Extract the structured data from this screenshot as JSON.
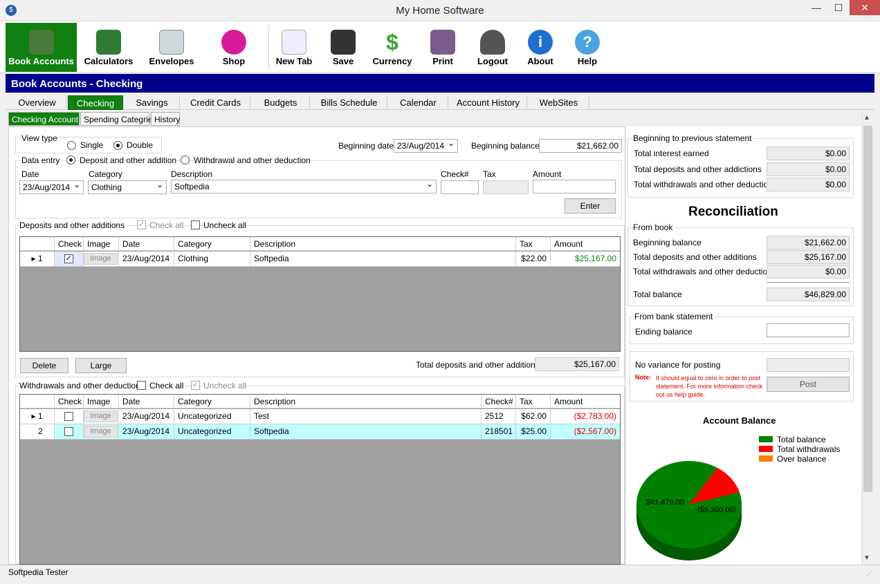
{
  "window": {
    "title": "My Home Software"
  },
  "toolbar": {
    "items": [
      {
        "label": "Book Accounts",
        "icon": "book-accounts-icon"
      },
      {
        "label": "Calculators",
        "icon": "calculator-icon"
      },
      {
        "label": "Envelopes",
        "icon": "envelopes-icon"
      },
      {
        "label": "Shop",
        "icon": "shop-icon"
      },
      {
        "label": "New Tab",
        "icon": "new-tab-icon"
      },
      {
        "label": "Save",
        "icon": "save-icon"
      },
      {
        "label": "Currency",
        "icon": "currency-icon"
      },
      {
        "label": "Print",
        "icon": "print-icon"
      },
      {
        "label": "Logout",
        "icon": "logout-icon"
      },
      {
        "label": "About",
        "icon": "about-icon"
      },
      {
        "label": "Help",
        "icon": "help-icon"
      }
    ]
  },
  "banner": {
    "title": "Book Accounts - Checking"
  },
  "tabs": [
    "Overview",
    "Checking",
    "Savings",
    "Credit Cards",
    "Budgets",
    "Bills Schedule",
    "Calendar",
    "Account History",
    "WebSites"
  ],
  "subtabs": [
    "Checking Account",
    "Spending Categries",
    "History"
  ],
  "view_type": {
    "label": "View type",
    "single": "Single",
    "double": "Double",
    "selected": "Double"
  },
  "beginning": {
    "date_label": "Beginning date",
    "date": "23/Aug/2014",
    "balance_label": "Beginning balance",
    "balance": "$21,662.00"
  },
  "data_entry": {
    "label": "Data entry",
    "deposit": "Deposit and other addition",
    "withdrawal": "Withdrawal and other deduction",
    "date_label": "Date",
    "date": "23/Aug/2014",
    "category_label": "Category",
    "category": "Clothing",
    "description_label": "Description",
    "description": "Softpedia",
    "check_label": "Check#",
    "tax_label": "Tax",
    "amount_label": "Amount",
    "enter": "Enter"
  },
  "deposits": {
    "title": "Deposits and other additions",
    "check_all": "Check all",
    "uncheck_all": "Uncheck all",
    "columns": [
      "Check",
      "Image",
      "Date",
      "Category",
      "Description",
      "Tax",
      "Amount"
    ],
    "rows": [
      {
        "n": "1",
        "image": "Image",
        "date": "23/Aug/2014",
        "category": "Clothing",
        "description": "Softpedia",
        "tax": "$22.00",
        "amount": "$25,167.00",
        "checked": true
      }
    ],
    "delete": "Delete",
    "large": "Large",
    "total_label": "Total deposits  and other additions",
    "total": "$25,167.00"
  },
  "withdrawals": {
    "title": "Withdrawals  and other deductions",
    "check_all": "Check all",
    "uncheck_all": "Uncheck all",
    "columns": [
      "Check",
      "Image",
      "Date",
      "Category",
      "Description",
      "Check#",
      "Tax",
      "Amount"
    ],
    "rows": [
      {
        "n": "1",
        "image": "Image",
        "date": "23/Aug/2014",
        "category": "Uncategorized",
        "description": "Test",
        "check": "2512",
        "tax": "$62.00",
        "amount": "($2,783.00)"
      },
      {
        "n": "2",
        "image": "Image",
        "date": "23/Aug/2014",
        "category": "Uncategorized",
        "description": "Softpedia",
        "check": "218501",
        "tax": "$25.00",
        "amount": "($2,567.00)"
      }
    ]
  },
  "prev_statement": {
    "title": "Beginning to previous statement",
    "rows": [
      {
        "label": "Total interest earned",
        "value": "$0.00"
      },
      {
        "label": "Total deposits and other addictions",
        "value": "$0.00"
      },
      {
        "label": "Total withdrawals and other deductions",
        "value": "$0.00"
      }
    ]
  },
  "reconciliation": {
    "title": "Reconciliation",
    "from_book": "From book",
    "rows": [
      {
        "label": "Beginning balance",
        "value": "$21,662.00"
      },
      {
        "label": "Total deposits and other additions",
        "value": "$25,167.00"
      },
      {
        "label": "Total withdrawals and other deductions",
        "value": "$0.00"
      }
    ],
    "total_label": "Total balance",
    "total": "$46,829.00"
  },
  "bank": {
    "title": "From bank statement",
    "ending_label": "Ending balance"
  },
  "posting": {
    "label": "No variance for posting",
    "note_label": "Note:",
    "note": "It should equal to zero in order to post statement. For more information check out us help guide.",
    "post": "Post"
  },
  "chart_data": {
    "type": "pie",
    "title": "Account Balance",
    "legend": [
      "Total balance",
      "Total withdrawals",
      "Over balance"
    ],
    "categories": [
      "Total balance",
      "Total withdrawals"
    ],
    "values": [
      41479,
      5350
    ],
    "labels": [
      "$41,479.00",
      "($5,350.00)"
    ],
    "colors": [
      "#008000",
      "#ff0000",
      "#ff8000"
    ]
  },
  "status": {
    "text": "Softpedia Tester"
  }
}
